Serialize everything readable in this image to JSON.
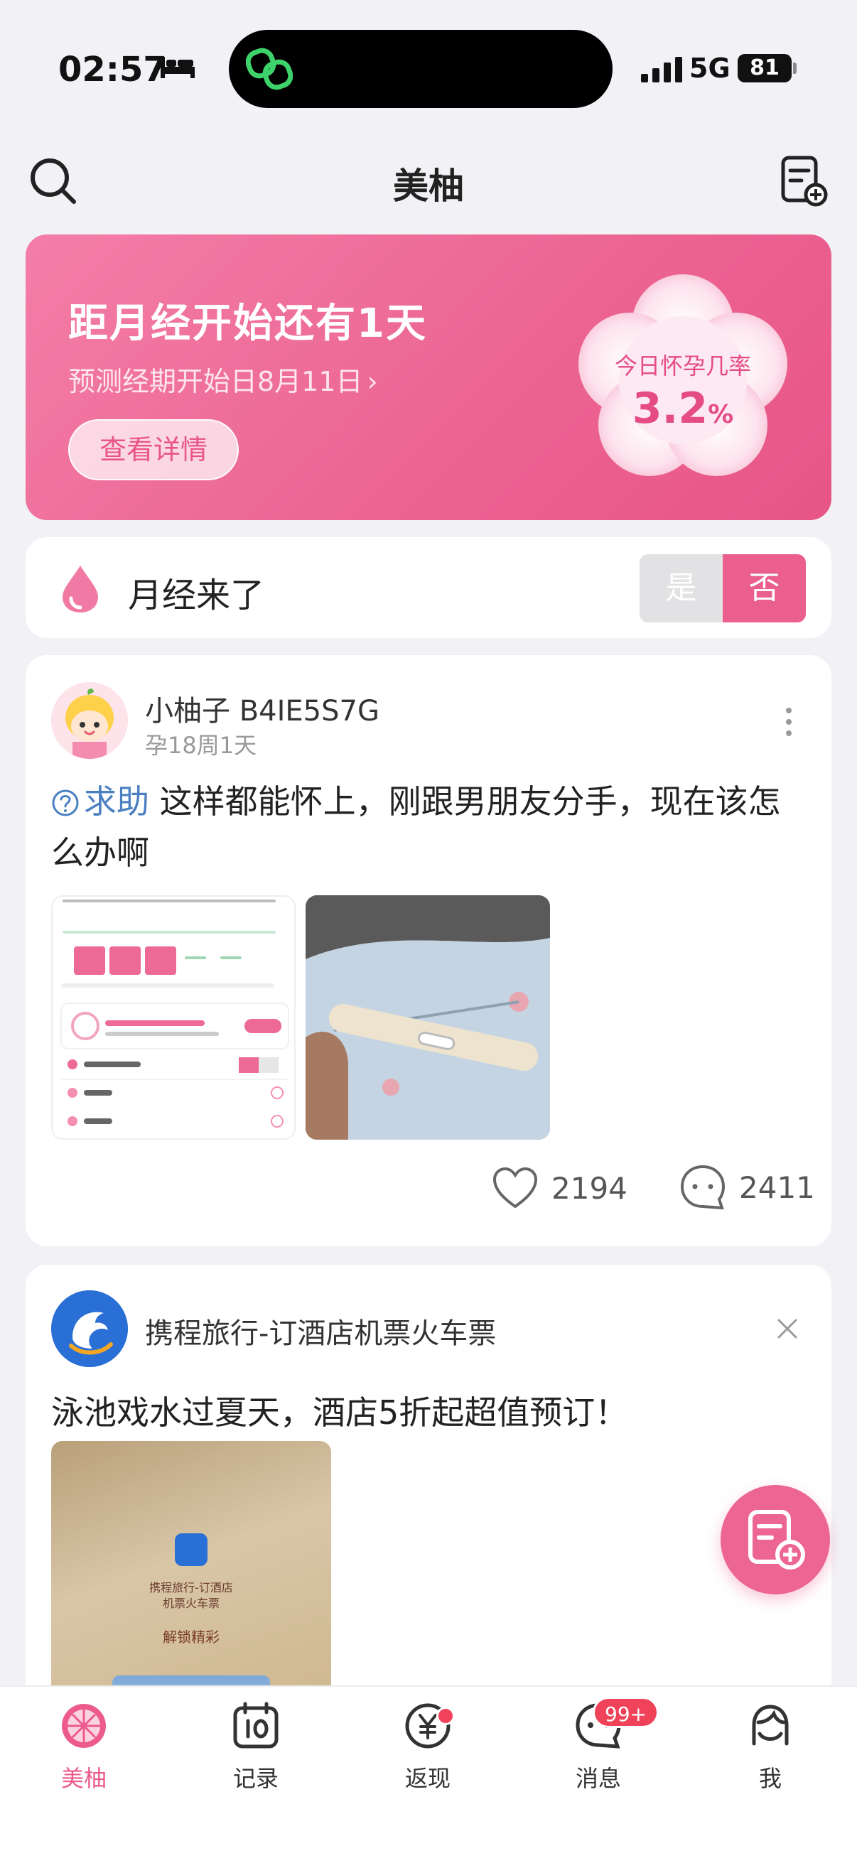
{
  "status_bar": {
    "time": "02:57",
    "network": "5G",
    "battery": "81"
  },
  "header": {
    "title": "美柚"
  },
  "banner": {
    "title": "距月经开始还有1天",
    "subtitle": "预测经期开始日8月11日",
    "details_label": "查看详情",
    "rate_label": "今日怀孕几率",
    "rate_value": "3.2",
    "rate_unit": "%"
  },
  "period_toggle": {
    "label": "月经来了",
    "yes": "是",
    "no": "否",
    "selected": "否"
  },
  "post": {
    "author": "小柚子 B4IE5S7G",
    "meta": "孕18周1天",
    "tag": "求助",
    "text": "这样都能怀上，刚跟男朋友分手，现在该怎么办啊",
    "likes": "2194",
    "comments": "2411"
  },
  "ad": {
    "name": "携程旅行-订酒店机票火车票",
    "text": "泳池戏水过夏天，酒店5折起超值预订！",
    "image_title": "携程旅行-订酒店\n机票火车票",
    "image_cta": "解锁精彩"
  },
  "tabbar": {
    "items": [
      {
        "label": "美柚",
        "icon": "grapefruit-icon",
        "active": true
      },
      {
        "label": "记录",
        "icon": "calendar-icon"
      },
      {
        "label": "返现",
        "icon": "yuan-icon"
      },
      {
        "label": "消息",
        "icon": "chat-icon"
      },
      {
        "label": "我",
        "icon": "profile-icon"
      }
    ],
    "message_badge": "99+"
  },
  "colors": {
    "accent": "#ec6593",
    "banner_start": "#f37ea7",
    "banner_end": "#e85587",
    "help_blue": "#4a7fc1"
  }
}
